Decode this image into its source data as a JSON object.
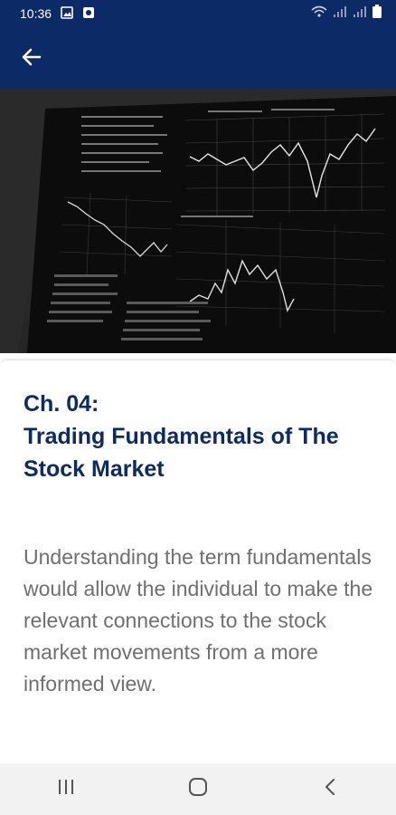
{
  "status_bar": {
    "time": "10:36",
    "icons": [
      "image-icon",
      "notification-icon",
      "wifi-icon",
      "signal-icon",
      "signal-icon",
      "battery-icon"
    ]
  },
  "app_bar": {
    "back_icon": "arrow-left-icon",
    "color": "#0b2a66"
  },
  "hero": {
    "description_icon": "stock-monitor-photo"
  },
  "chapter": {
    "title_line1": "Ch. 04:",
    "title_line2": "Trading Fundamentals of The Stock Market",
    "body": "Understanding the term fundamentals would allow the individual to make the relevant connections to the stock market movements from a more informed view."
  },
  "nav_bar": {
    "icons": [
      "recent-apps-icon",
      "home-icon",
      "back-nav-icon"
    ]
  },
  "colors": {
    "primary": "#0b2a66",
    "body_text": "#6f6f6f"
  }
}
